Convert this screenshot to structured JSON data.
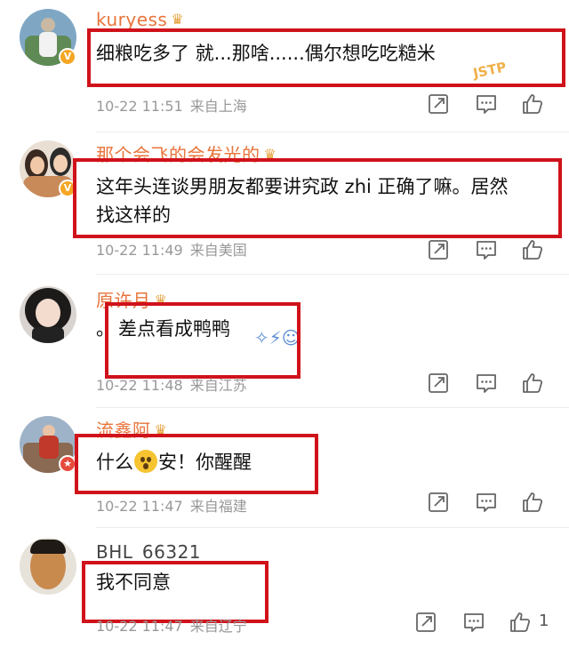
{
  "comments": [
    {
      "username": "kuryess",
      "crown": "♛",
      "text": "细粮吃多了 就...那啥......偶尔想吃吃糙米",
      "time": "10-22 11:51",
      "location": "来自上海",
      "sticker": "JSTP"
    },
    {
      "username": "那个会飞的会发光的",
      "crown": "♛",
      "text_line1": "这年头连谈男朋友都要讲究政 zhi 正确了嘛。居然",
      "text_line2": "找这样的",
      "time": "10-22 11:49",
      "location": "来自美国"
    },
    {
      "username": "原许月",
      "crown": "♛",
      "text": "差点看成鸭鸭",
      "text_prefix": "。",
      "time": "10-22 11:48",
      "location": "来自江苏"
    },
    {
      "username": "流鑫阿",
      "crown": "♛",
      "text_before": "什么",
      "text_after": "安！你醒醒",
      "time": "10-22 11:47",
      "location": "来自福建"
    },
    {
      "username": "BHL_66321",
      "text": "我不同意",
      "time": "10-22 11:47",
      "location": "来自辽宁",
      "like_count": "1"
    }
  ],
  "colors": {
    "highlight_box": "#d0121b",
    "vip_name": "#e8743b",
    "meta_text": "#999999"
  },
  "icons": [
    "share-icon",
    "comment-icon",
    "like-icon"
  ]
}
